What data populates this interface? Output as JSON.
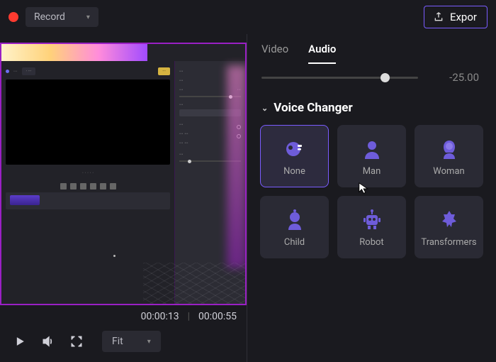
{
  "topbar": {
    "record_label": "Record",
    "export_label": "Expor"
  },
  "preview": {
    "current_time": "00:00:13",
    "total_time": "00:00:55",
    "fit_label": "Fit"
  },
  "tabs": {
    "video": "Video",
    "audio": "Audio"
  },
  "gain": {
    "value": "-25.00"
  },
  "section": {
    "title": "Voice Changer"
  },
  "voices": [
    {
      "label": "None",
      "icon": "none",
      "selected": true
    },
    {
      "label": "Man",
      "icon": "man",
      "selected": false
    },
    {
      "label": "Woman",
      "icon": "woman",
      "selected": false
    },
    {
      "label": "Child",
      "icon": "child",
      "selected": false
    },
    {
      "label": "Robot",
      "icon": "robot",
      "selected": false
    },
    {
      "label": "Transformers",
      "icon": "transformers",
      "selected": false
    }
  ]
}
